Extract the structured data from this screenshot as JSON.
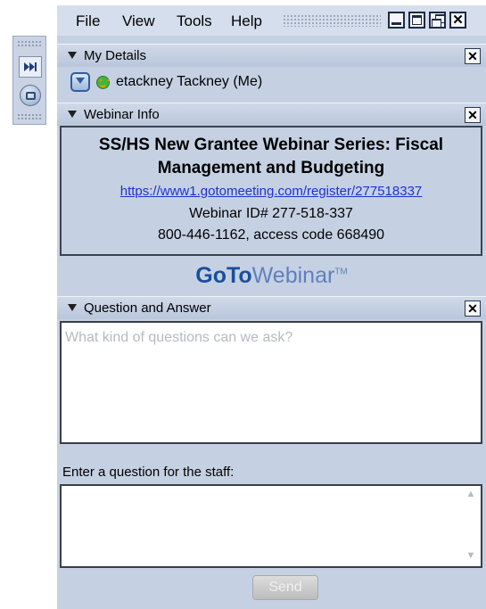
{
  "menu": {
    "file": "File",
    "view": "View",
    "tools": "Tools",
    "help": "Help"
  },
  "window_controls": [
    "minimize-icon",
    "maximize-icon",
    "restore-icon",
    "close-icon"
  ],
  "my_details": {
    "header": "My Details",
    "user_name": "etackney Tackney (Me)"
  },
  "webinar_info": {
    "header": "Webinar Info",
    "title": "SS/HS New Grantee Webinar Series: Fiscal Management and Budgeting",
    "register_link": "https://www1.gotomeeting.com/register/277518337",
    "webinar_id": "Webinar ID# 277-518-337",
    "phone": "800-446-1162, access code 668490"
  },
  "brand": {
    "go": "GoTo",
    "webinar": "Webinar",
    "tm": "TM"
  },
  "qa": {
    "header": "Question and Answer",
    "log_text": "What kind of questions can we ask?",
    "enter_label": "Enter a question for the staff:",
    "input_value": "",
    "send_label": "Send"
  },
  "colors": {
    "panel_bg": "#c5d1e3",
    "link": "#2031cc",
    "brand": "#1b4e9e"
  }
}
